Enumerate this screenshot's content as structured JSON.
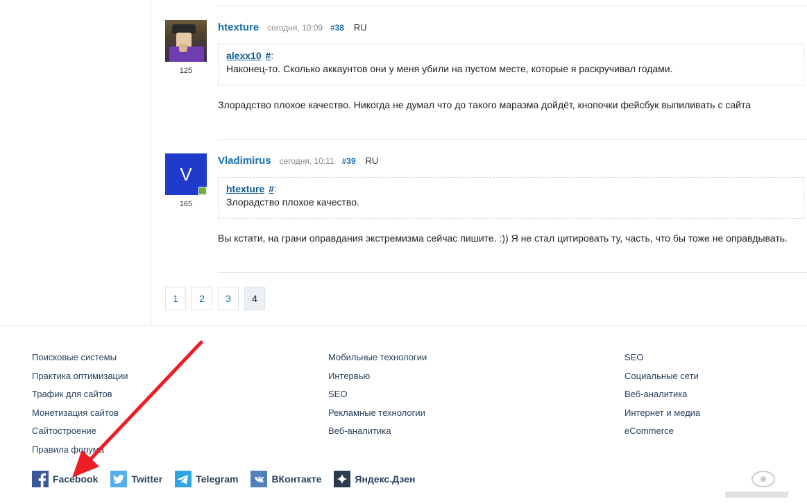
{
  "posts": [
    {
      "author": "htexture",
      "date": "сегодня, 10:09",
      "number": "#38",
      "lang": "RU",
      "rep": "125",
      "avatar_letter": "",
      "quote": {
        "author": "alexx10",
        "hash": "#",
        "colon": ":",
        "text": "Наконец-то. Сколько аккаунтов они у меня убили на пустом месте, которые я раскручивал годами."
      },
      "body": "Злорадство плохое качество. Никогда не думал что до такого маразма дойдёт, кнопочки фейсбук выпиливать с сайта"
    },
    {
      "author": "Vladimirus",
      "date": "сегодня, 10:11",
      "number": "#39",
      "lang": "RU",
      "rep": "165",
      "avatar_letter": "V",
      "quote": {
        "author": "htexture",
        "hash": "#",
        "colon": ":",
        "text": "Злорадство плохое качество."
      },
      "body": "Вы кстати, на грани оправдания экстремизма сейчас пишите. :)) Я не стал цитировать ту, часть, что бы тоже не оправдывать."
    }
  ],
  "pagination": {
    "pages": [
      "1",
      "2",
      "3",
      "4"
    ],
    "current": "4"
  },
  "footer": {
    "col1": [
      "Поисковые системы",
      "Практика оптимизации",
      "Трафик для сайтов",
      "Монетизация сайтов",
      "Сайтостроение",
      "Правила форума"
    ],
    "col2": [
      "Мобильные технологии",
      "Интервью",
      "SEO",
      "Рекламные технологии",
      "Веб-аналитика"
    ],
    "col3": [
      "SEO",
      "Социальные сети",
      "Веб-аналитика",
      "Интернет и медиа",
      "eCommerce"
    ]
  },
  "social": [
    {
      "label": "Facebook",
      "icon": "facebook-icon",
      "color": "#3b5998"
    },
    {
      "label": "Twitter",
      "icon": "twitter-icon",
      "color": "#55acee"
    },
    {
      "label": "Telegram",
      "icon": "telegram-icon",
      "color": "#2ca5e0"
    },
    {
      "label": "ВКонтакте",
      "icon": "vk-icon",
      "color": "#5181b8"
    },
    {
      "label": "Яндекс.Дзен",
      "icon": "zen-icon",
      "color": "#2b3a4f"
    }
  ],
  "colors": {
    "link": "#1a6fad",
    "annotation_arrow": "#ee1c24",
    "avatar_blue": "#1f3bcc",
    "online": "#67b432"
  },
  "watermark": "joxi / screenshot logo"
}
